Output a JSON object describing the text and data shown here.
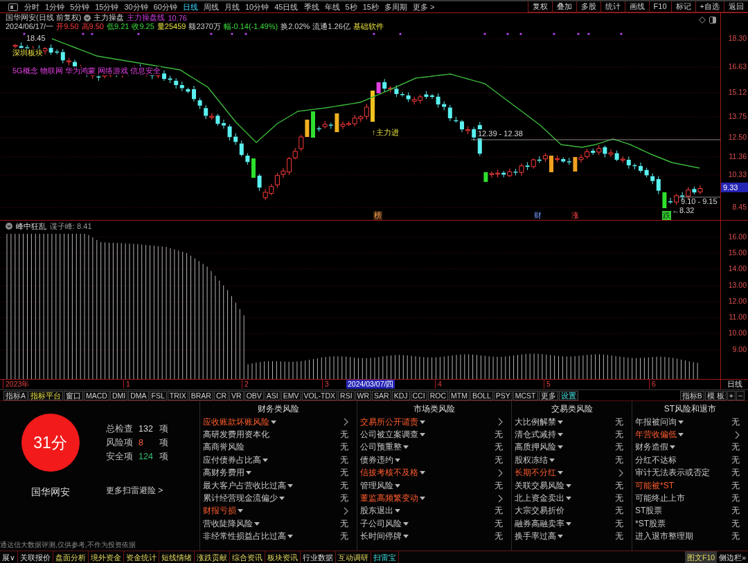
{
  "toolbar": {
    "periods": [
      {
        "label": "分时",
        "selected": false
      },
      {
        "label": "1分钟",
        "selected": false
      },
      {
        "label": "5分钟",
        "selected": false
      },
      {
        "label": "15分钟",
        "selected": false
      },
      {
        "label": "30分钟",
        "selected": false
      },
      {
        "label": "60分钟",
        "selected": false
      },
      {
        "label": "日线",
        "selected": true
      },
      {
        "label": "周线",
        "selected": false
      },
      {
        "label": "月线",
        "selected": false
      },
      {
        "label": "10分钟",
        "selected": false
      },
      {
        "label": "45日线",
        "selected": false
      },
      {
        "label": "季线",
        "selected": false
      },
      {
        "label": "年线",
        "selected": false
      },
      {
        "label": "5秒",
        "selected": false
      },
      {
        "label": "15秒",
        "selected": false
      },
      {
        "label": "多周期",
        "selected": false
      }
    ],
    "more": "更多 >",
    "actions": [
      "复权",
      "叠加",
      "多股",
      "统计",
      "画线",
      "F10",
      "标记",
      "+自选",
      "返回"
    ]
  },
  "header": {
    "title": "国华网安(日线 前复权)",
    "indicator": "主力操盘",
    "line_name": "主力操盘线",
    "line_value": "10.76",
    "quote": [
      {
        "text": "2024/06/17/一",
        "kind": "plain"
      },
      {
        "text": "开9.50",
        "kind": "up"
      },
      {
        "text": "高9.50",
        "kind": "up"
      },
      {
        "text": "低9.21",
        "kind": "down"
      },
      {
        "text": "收9.25",
        "kind": "down"
      },
      {
        "text": "量25459",
        "kind": "volume"
      },
      {
        "text": "额2370万",
        "kind": "plain"
      },
      {
        "text": "幅-0.14(-1.49%)",
        "kind": "down"
      },
      {
        "text": "换2.02%",
        "kind": "plain"
      },
      {
        "text": "流通1.26亿",
        "kind": "plain"
      },
      {
        "text": "基础软件",
        "kind": "sector"
      }
    ]
  },
  "main_chart": {
    "price_ticks": [
      "18.30",
      "16.63",
      "15.12",
      "13.75",
      "12.50",
      "11.36",
      "10.33",
      "8.45"
    ],
    "last_price": "9.33",
    "labels": [
      {
        "text": "18.45",
        "kind": "price"
      },
      {
        "text": "深圳板块",
        "kind": "sector"
      },
      {
        "text": "5G概念 物联网 华为鸿蒙 网络游戏 信息安全",
        "kind": "concept"
      },
      {
        "text": "↑主力进",
        "kind": "signal"
      },
      {
        "text": "12.39 - 12.38",
        "kind": "price"
      },
      {
        "text": "9.10 - 9.15",
        "kind": "price"
      },
      {
        "text": "←8.32",
        "kind": "price"
      }
    ],
    "markers": [
      {
        "text": "榜",
        "kind": "list"
      },
      {
        "text": "财",
        "kind": "finance"
      },
      {
        "text": "涨",
        "kind": "rise"
      },
      {
        "text": "跌",
        "kind": "fall"
      }
    ]
  },
  "lower_chart": {
    "title": "峰中狂乱",
    "reading": "谍子峰: 8.41",
    "ticks": [
      "16.00",
      "15.00",
      "14.00",
      "13.00",
      "12.00",
      "11.00",
      "10.00",
      "9.00"
    ]
  },
  "time_axis": {
    "labels": [
      {
        "text": "2023年",
        "kind": "year"
      },
      {
        "text": "1",
        "kind": "month"
      },
      {
        "text": "2",
        "kind": "month"
      },
      {
        "text": "3",
        "kind": "month"
      },
      {
        "text": "2024/03/07/四",
        "kind": "cursor"
      },
      {
        "text": "4",
        "kind": "month"
      },
      {
        "text": "5",
        "kind": "month"
      },
      {
        "text": "6",
        "kind": "month"
      }
    ],
    "period": "日线"
  },
  "indicator_bar": {
    "tabs": [
      {
        "label": "指标A",
        "kind": "plain"
      },
      {
        "label": "指标平台",
        "kind": "platform"
      },
      {
        "label": "窗口",
        "kind": "plain"
      },
      {
        "label": "MACD",
        "kind": "plain"
      },
      {
        "label": "DMI",
        "kind": "plain"
      },
      {
        "label": "DMA",
        "kind": "plain"
      },
      {
        "label": "FSL",
        "kind": "plain"
      },
      {
        "label": "TRIX",
        "kind": "plain"
      },
      {
        "label": "BRAR",
        "kind": "plain"
      },
      {
        "label": "CR",
        "kind": "plain"
      },
      {
        "label": "VR",
        "kind": "plain"
      },
      {
        "label": "OBV",
        "kind": "plain"
      },
      {
        "label": "ASI",
        "kind": "plain"
      },
      {
        "label": "EMV",
        "kind": "plain"
      },
      {
        "label": "VOL-TDX",
        "kind": "plain"
      },
      {
        "label": "RSI",
        "kind": "plain"
      },
      {
        "label": "WR",
        "kind": "plain"
      },
      {
        "label": "SAR",
        "kind": "plain"
      },
      {
        "label": "KDJ",
        "kind": "plain"
      },
      {
        "label": "CCI",
        "kind": "plain"
      },
      {
        "label": "ROC",
        "kind": "plain"
      },
      {
        "label": "MTM",
        "kind": "plain"
      },
      {
        "label": "BOLL",
        "kind": "plain"
      },
      {
        "label": "PSY",
        "kind": "plain"
      },
      {
        "label": "MCST",
        "kind": "plain"
      },
      {
        "label": "更多",
        "kind": "plain"
      },
      {
        "label": "设置",
        "kind": "settings"
      }
    ],
    "right": [
      "指标B",
      "模 板",
      "+",
      "−"
    ]
  },
  "risk": {
    "score": "31分",
    "stock": "国华网安",
    "summary": [
      {
        "label": "总检查",
        "count": "132",
        "unit": "项",
        "kind": "total"
      },
      {
        "label": "风险项",
        "count": "8",
        "unit": "项",
        "kind": "risk"
      },
      {
        "label": "安全项",
        "count": "124",
        "unit": "项",
        "kind": "safe"
      }
    ],
    "more_link": "更多扫雷避险 >",
    "disclaimer": "通达信大数据评测,仅供参考,不作为投资依据",
    "groups": [
      {
        "title": "财务类风险",
        "items": [
          {
            "name": "应收账款坏账风险",
            "warn": true,
            "menu": true,
            "linked": true
          },
          {
            "name": "高研发费用资本化",
            "warn": false,
            "menu": false,
            "linked": false,
            "result": "无"
          },
          {
            "name": "高商誉风险",
            "warn": false,
            "menu": false,
            "linked": false,
            "result": "无"
          },
          {
            "name": "应付债券占比高",
            "warn": false,
            "menu": true,
            "linked": false,
            "result": "无"
          },
          {
            "name": "高财务费用",
            "warn": false,
            "menu": true,
            "linked": false,
            "result": "无"
          },
          {
            "name": "最大客户占营收比过高",
            "warn": false,
            "menu": true,
            "linked": false,
            "result": "无"
          },
          {
            "name": "累计经营现金流偏少",
            "warn": false,
            "menu": true,
            "linked": false,
            "result": "无"
          },
          {
            "name": "财报亏损",
            "warn": true,
            "menu": true,
            "linked": true
          },
          {
            "name": "营收陡降风险",
            "warn": false,
            "menu": true,
            "linked": false,
            "result": "无"
          },
          {
            "name": "非经常性损益占比过高",
            "warn": false,
            "menu": true,
            "linked": false,
            "result": "无"
          }
        ]
      },
      {
        "title": "市场类风险",
        "items": [
          {
            "name": "交易所公开谴责",
            "warn": true,
            "menu": true,
            "linked": true
          },
          {
            "name": "公司被立案调查",
            "warn": false,
            "menu": true,
            "linked": false,
            "result": "无"
          },
          {
            "name": "公司预重整",
            "warn": false,
            "menu": true,
            "linked": false,
            "result": "无"
          },
          {
            "name": "债券违约",
            "warn": false,
            "menu": true,
            "linked": false,
            "result": "无"
          },
          {
            "name": "信披考核不及格",
            "warn": true,
            "menu": true,
            "linked": true
          },
          {
            "name": "管理风险",
            "warn": false,
            "menu": true,
            "linked": false,
            "result": "无"
          },
          {
            "name": "董监高频繁变动",
            "warn": true,
            "menu": true,
            "linked": true
          },
          {
            "name": "股东退出",
            "warn": false,
            "menu": true,
            "linked": false,
            "result": "无"
          },
          {
            "name": "子公司风险",
            "warn": false,
            "menu": true,
            "linked": false,
            "result": "无"
          },
          {
            "name": "长时间停牌",
            "warn": false,
            "menu": true,
            "linked": false,
            "result": "无"
          }
        ]
      },
      {
        "title": "交易类风险",
        "items": [
          {
            "name": "大比例解禁",
            "warn": false,
            "menu": true,
            "linked": false,
            "result": "无"
          },
          {
            "name": "清仓式减持",
            "warn": false,
            "menu": true,
            "linked": false,
            "result": "无"
          },
          {
            "name": "高质押风险",
            "warn": false,
            "menu": true,
            "linked": false,
            "result": "无"
          },
          {
            "name": "股权冻结",
            "warn": false,
            "menu": true,
            "linked": false,
            "result": "无"
          },
          {
            "name": "长期不分红",
            "warn": true,
            "menu": true,
            "linked": true
          },
          {
            "name": "关联交易风险",
            "warn": false,
            "menu": true,
            "linked": false,
            "result": "无"
          },
          {
            "name": "北上资金卖出",
            "warn": false,
            "menu": true,
            "linked": false,
            "result": "无"
          },
          {
            "name": "大宗交易折价",
            "warn": false,
            "menu": false,
            "linked": false,
            "result": "无"
          },
          {
            "name": "融券高融卖率",
            "warn": false,
            "menu": true,
            "linked": false,
            "result": "无"
          },
          {
            "name": "换手率过高",
            "warn": false,
            "menu": true,
            "linked": false,
            "result": "无"
          }
        ]
      },
      {
        "title": "ST风险和退市",
        "items": [
          {
            "name": "年报被问询",
            "warn": false,
            "menu": true,
            "linked": false,
            "result": "无"
          },
          {
            "name": "年营收偏低",
            "warn": true,
            "menu": true,
            "linked": true
          },
          {
            "name": "财务造假",
            "warn": false,
            "menu": true,
            "linked": false,
            "result": "无"
          },
          {
            "name": "分红不达标",
            "warn": false,
            "menu": false,
            "linked": false,
            "result": "无"
          },
          {
            "name": "审计无法表示或否定",
            "warn": false,
            "menu": false,
            "linked": false,
            "result": "无"
          },
          {
            "name": "可能被*ST",
            "warn": true,
            "menu": false,
            "linked": false,
            "result": "无"
          },
          {
            "name": "可能终止上市",
            "warn": false,
            "menu": false,
            "linked": false,
            "result": "无"
          },
          {
            "name": "ST股票",
            "warn": false,
            "menu": false,
            "linked": false,
            "result": "无"
          },
          {
            "name": "*ST股票",
            "warn": false,
            "menu": false,
            "linked": false,
            "result": "无"
          },
          {
            "name": "进入退市整理期",
            "warn": false,
            "menu": false,
            "linked": false,
            "result": "无"
          }
        ]
      }
    ]
  },
  "bottom_nav": {
    "tabs": [
      {
        "label": "展∨",
        "kind": "plain",
        "selected": false
      },
      {
        "label": "关联报价",
        "kind": "plain",
        "selected": false
      },
      {
        "label": "盘面分析",
        "kind": "feature",
        "selected": false
      },
      {
        "label": "境外资金",
        "kind": "feature",
        "selected": false
      },
      {
        "label": "资金统计",
        "kind": "feature",
        "selected": false
      },
      {
        "label": "短线情绪",
        "kind": "feature",
        "selected": false
      },
      {
        "label": "涨跌贡献",
        "kind": "feature",
        "selected": false
      },
      {
        "label": "综合资讯",
        "kind": "feature",
        "selected": false
      },
      {
        "label": "板块资讯",
        "kind": "feature",
        "selected": false
      },
      {
        "label": "行业数据",
        "kind": "plain",
        "selected": false
      },
      {
        "label": "互动调研",
        "kind": "feature",
        "selected": false
      },
      {
        "label": "扫雷宝",
        "kind": "feature",
        "selected": true
      }
    ],
    "right": [
      {
        "label": "图文F10",
        "kind": "feature"
      },
      {
        "label": "侧边栏»",
        "kind": "plain"
      }
    ]
  }
}
